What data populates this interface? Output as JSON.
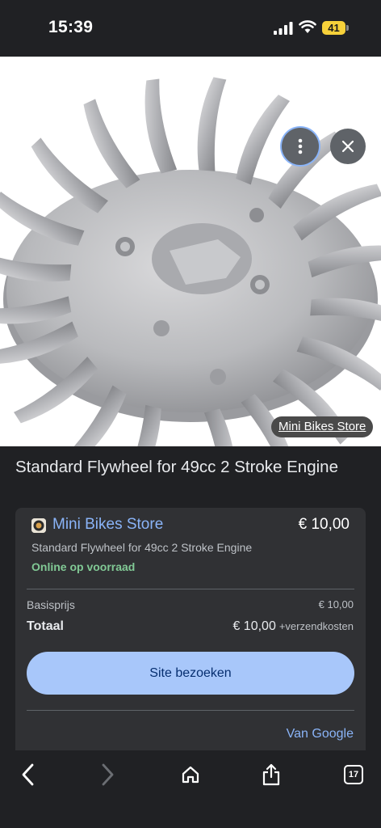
{
  "status_bar": {
    "time": "15:39",
    "battery": "41"
  },
  "image": {
    "source_label": "Mini Bikes Store"
  },
  "product": {
    "title": "Standard Flywheel for 49cc 2 Stroke Engine"
  },
  "offer": {
    "store_name": "Mini Bikes Store",
    "price": "€ 10,00",
    "description": "Standard Flywheel for 49cc 2 Stroke Engine",
    "stock": "Online op voorraad",
    "base_label": "Basisprijs",
    "base_value": "€ 10,00",
    "total_label": "Totaal",
    "total_value": "€ 10,00",
    "shipping_note": "+verzendkosten",
    "visit_label": "Site bezoeken",
    "from_google": "Van Google"
  },
  "toolbar": {
    "tab_count": "17"
  },
  "colors": {
    "background": "#202124",
    "card": "#303134",
    "link": "#8ab4f8",
    "stock": "#81c995",
    "button": "#a8c7fa",
    "battery": "#f7d13a"
  },
  "icons": [
    "signal-icon",
    "wifi-icon",
    "more-vert-icon",
    "close-icon",
    "back-icon",
    "forward-icon",
    "home-icon",
    "share-icon",
    "tabs-icon"
  ]
}
